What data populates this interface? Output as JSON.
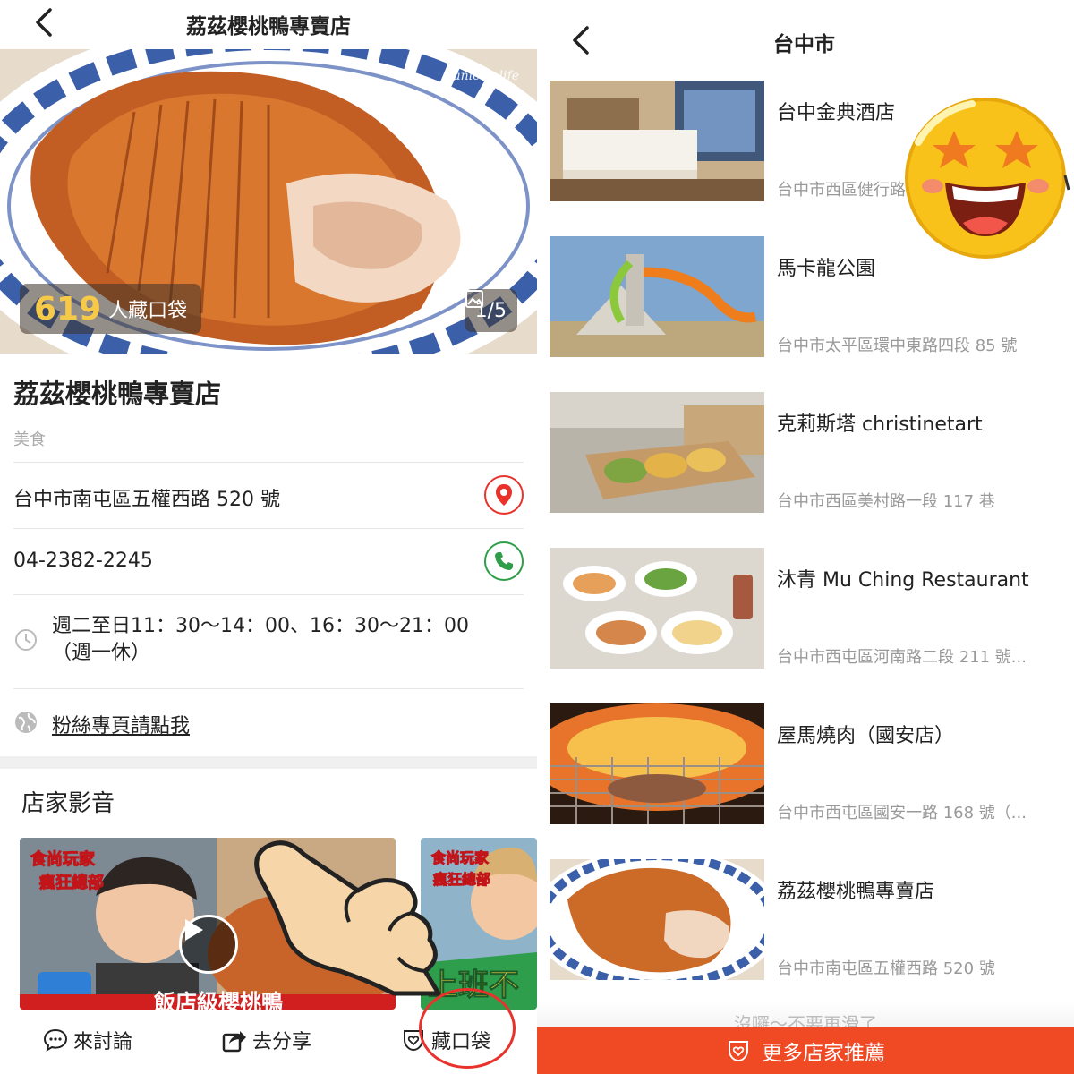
{
  "left": {
    "header_title": "荔茲櫻桃鴨專賣店",
    "hero": {
      "watermark": "janice . life",
      "saved_count": "619",
      "saved_label": "人藏口袋",
      "image_counter": "1/5"
    },
    "shop_name": "荔茲櫻桃鴨專賣店",
    "category": "美食",
    "address": "台中市南屯區五權西路 520 號",
    "phone": "04-2382-2245",
    "hours_line1": "週二至日11：30～14：00、16：30～21：00",
    "hours_line2": "（週一休）",
    "fan_page_link": "粉絲專頁請點我",
    "videos_title": "店家影音",
    "video1": {
      "logo_text": "食尚玩家",
      "logo_sub": "瘋狂總部",
      "banner": "飯店級櫻桃鴨"
    },
    "video2": {
      "logo_text": "食尚玩家",
      "logo_sub": "瘋狂總部",
      "banner": "上班不"
    },
    "bottom_bar": {
      "discuss": "來討論",
      "share": "去分享",
      "save": "藏口袋"
    }
  },
  "right": {
    "header_title": "台中市",
    "items": [
      {
        "name": "台中金典酒店",
        "address": "台中市西區健行路"
      },
      {
        "name": "馬卡龍公園",
        "address": "台中市太平區環中東路四段 85 號"
      },
      {
        "name": "克莉斯塔 christinetart",
        "address": "台中市西區美村路一段 117 巷"
      },
      {
        "name": "沐青 Mu Ching Restaurant",
        "address": "台中市西屯區河南路二段 211 號..."
      },
      {
        "name": "屋馬燒肉（國安店）",
        "address": "台中市西屯區國安一路 168 號（..."
      },
      {
        "name": "荔茲櫻桃鴨專賣店",
        "address": "台中市南屯區五權西路 520 號"
      }
    ],
    "end_text": "沒囉～不要再滑了",
    "more_button": "更多店家推薦"
  },
  "colors": {
    "accent": "#f04a25",
    "map_pin": "#e8322b",
    "phone": "#2e9e48",
    "gold": "#f7c948"
  },
  "icons": [
    "back-chevron-icon",
    "image-icon",
    "map-pin-icon",
    "phone-icon",
    "clock-icon",
    "globe-icon",
    "play-icon",
    "chat-icon",
    "share-icon",
    "heart-pocket-icon",
    "star-eyes-emoji-icon",
    "pointing-hand-icon"
  ]
}
